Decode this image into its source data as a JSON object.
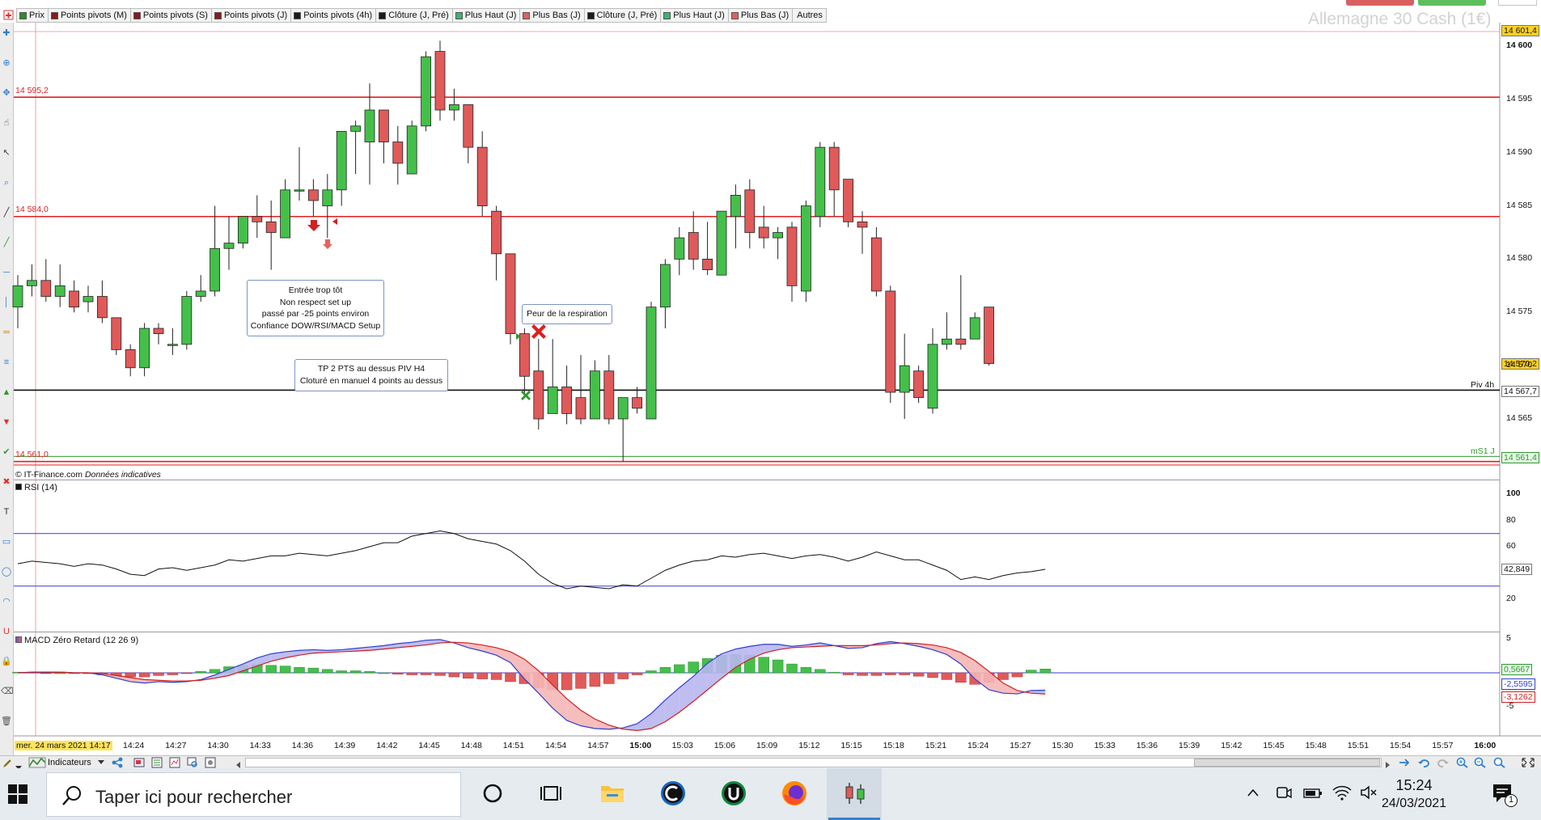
{
  "toolbar": {
    "tabs": [
      {
        "label": "Prix",
        "color": "#2e8b2e"
      },
      {
        "label": "Points pivots (M)",
        "color": "#8b1a1a"
      },
      {
        "label": "Points pivots (S)",
        "color": "#8b1a1a"
      },
      {
        "label": "Points pivots (J)",
        "color": "#8b1a1a"
      },
      {
        "label": "Points pivots (4h)",
        "color": "#1a1a1a"
      },
      {
        "label": "Clôture (J, Pré)",
        "color": "#1a1a1a"
      },
      {
        "label": "Plus Haut (J)",
        "color": "#3cb371"
      },
      {
        "label": "Plus Bas (J)",
        "color": "#e06060"
      },
      {
        "label": "Clôture (J, Pré)",
        "color": "#1a1a1a"
      },
      {
        "label": "Plus Haut (J)",
        "color": "#3cb371"
      },
      {
        "label": "Plus Bas (J)",
        "color": "#e06060"
      },
      {
        "label": "Autres",
        "color": ""
      }
    ],
    "instrument_title": "Allemagne 30 Cash (1€)"
  },
  "price_pane": {
    "copyright": "© IT-Finance.com",
    "disclaimer": "Données indicatives",
    "levels": [
      {
        "label": "14 595,2",
        "value": 14595.2,
        "color": "#e02020"
      },
      {
        "label": "14 584,0",
        "value": 14584.0,
        "color": "#e02020"
      },
      {
        "label": "14 561,0",
        "value": 14561.0,
        "color": "#e02020"
      }
    ],
    "pivot_4h": {
      "label": "Piv 4h",
      "value": 14567.7,
      "tag": "14 567,7"
    },
    "ms1_j": {
      "label": "mS1 J",
      "value": 14561.4,
      "tag": "14 561,4"
    },
    "top_tag": "14 601,4",
    "last_price_tag": "14 570,2",
    "price_ticks": [
      "14 600",
      "14 595",
      "14 590",
      "14 585",
      "14 580",
      "14 575",
      "14 570",
      "14 565"
    ],
    "annotations": {
      "note1": [
        "Entrée trop tôt",
        "Non respect set up",
        "passé par -25 points environ",
        "Confiance DOW/RSI/MACD Setup"
      ],
      "note2": [
        "Peur de la respiration"
      ],
      "note3": [
        "TP 2 PTS au dessus PIV H4",
        "Cloturé en manuel 4 points au dessus"
      ]
    }
  },
  "rsi_pane": {
    "label": "RSI (14)",
    "ticks": [
      "100",
      "80",
      "60",
      "40",
      "20"
    ],
    "value_tag": "42,849",
    "upper": 70,
    "lower": 30
  },
  "macd_pane": {
    "label": "MACD Zéro Retard (12 26 9)",
    "ticks": [
      "5",
      "0",
      "-5"
    ],
    "tag_hist": "0,5667",
    "tag_macd": "-2,5595",
    "tag_signal": "-3,1262"
  },
  "time_axis": {
    "date_label": "mer. 24 mars 2021 14:17",
    "labels": [
      "14:24",
      "14:27",
      "14:30",
      "14:33",
      "14:36",
      "14:39",
      "14:42",
      "14:45",
      "14:48",
      "14:51",
      "14:54",
      "14:57",
      "15:00",
      "15:03",
      "15:06",
      "15:09",
      "15:12",
      "15:15",
      "15:18",
      "15:21",
      "15:24",
      "15:27",
      "15:30",
      "15:33",
      "15:36",
      "15:39",
      "15:42",
      "15:45",
      "15:48",
      "15:51",
      "15:54",
      "15:57",
      "16:00"
    ]
  },
  "bottom_toolbar": {
    "indicators_label": "Indicateurs"
  },
  "taskbar": {
    "search_placeholder": "Taper ici pour rechercher",
    "time": "15:24",
    "date": "24/03/2021",
    "notif_count": "1"
  },
  "chart_data": {
    "type": "candlestick",
    "instrument": "Allemagne 30 Cash (1€)",
    "timeframe_minutes": 1,
    "start_time": "14:17",
    "y_range": [
      14561,
      14602
    ],
    "candles": [
      {
        "t": "14:17",
        "o": 14575.5,
        "h": 14578.5,
        "l": 14573.5,
        "c": 14577.5
      },
      {
        "t": "14:18",
        "o": 14577.5,
        "h": 14579.5,
        "l": 14576.5,
        "c": 14578.0
      },
      {
        "t": "14:19",
        "o": 14578.0,
        "h": 14580.0,
        "l": 14576.0,
        "c": 14576.5
      },
      {
        "t": "14:20",
        "o": 14576.5,
        "h": 14579.5,
        "l": 14575.5,
        "c": 14577.5
      },
      {
        "t": "14:21",
        "o": 14577.0,
        "h": 14578.0,
        "l": 14575.0,
        "c": 14575.5
      },
      {
        "t": "14:22",
        "o": 14576.0,
        "h": 14577.5,
        "l": 14575.0,
        "c": 14576.5
      },
      {
        "t": "14:23",
        "o": 14576.5,
        "h": 14578.0,
        "l": 14574.0,
        "c": 14574.5
      },
      {
        "t": "14:24",
        "o": 14574.5,
        "h": 14574.5,
        "l": 14571.0,
        "c": 14571.5
      },
      {
        "t": "14:25",
        "o": 14571.5,
        "h": 14572.0,
        "l": 14569.0,
        "c": 14569.8
      },
      {
        "t": "14:26",
        "o": 14569.8,
        "h": 14574.0,
        "l": 14569.0,
        "c": 14573.5
      },
      {
        "t": "14:27",
        "o": 14573.5,
        "h": 14574.0,
        "l": 14572.0,
        "c": 14573.0
      },
      {
        "t": "14:28",
        "o": 14572.0,
        "h": 14573.5,
        "l": 14571.0,
        "c": 14572.0
      },
      {
        "t": "14:29",
        "o": 14572.0,
        "h": 14577.0,
        "l": 14571.5,
        "c": 14576.5
      },
      {
        "t": "14:30",
        "o": 14576.5,
        "h": 14578.5,
        "l": 14576.0,
        "c": 14577.0
      },
      {
        "t": "14:31",
        "o": 14577.0,
        "h": 14585.0,
        "l": 14576.5,
        "c": 14581.0
      },
      {
        "t": "14:32",
        "o": 14581.0,
        "h": 14584.0,
        "l": 14579.0,
        "c": 14581.5
      },
      {
        "t": "14:33",
        "o": 14581.5,
        "h": 14584.0,
        "l": 14581.0,
        "c": 14584.0
      },
      {
        "t": "14:34",
        "o": 14584.0,
        "h": 14586.0,
        "l": 14582.0,
        "c": 14583.5
      },
      {
        "t": "14:35",
        "o": 14583.5,
        "h": 14585.5,
        "l": 14579.0,
        "c": 14582.5
      },
      {
        "t": "14:36",
        "o": 14582.0,
        "h": 14587.5,
        "l": 14582.0,
        "c": 14586.5
      },
      {
        "t": "14:37",
        "o": 14586.5,
        "h": 14590.5,
        "l": 14585.5,
        "c": 14586.5
      },
      {
        "t": "14:38",
        "o": 14586.5,
        "h": 14587.5,
        "l": 14584.0,
        "c": 14585.5
      },
      {
        "t": "14:39",
        "o": 14585.0,
        "h": 14588.0,
        "l": 14582.0,
        "c": 14586.5
      },
      {
        "t": "14:40",
        "o": 14586.5,
        "h": 14592.0,
        "l": 14585.0,
        "c": 14592.0
      },
      {
        "t": "14:41",
        "o": 14592.0,
        "h": 14593.0,
        "l": 14588.0,
        "c": 14592.5
      },
      {
        "t": "14:42",
        "o": 14591.0,
        "h": 14596.5,
        "l": 14587.0,
        "c": 14594.0
      },
      {
        "t": "14:43",
        "o": 14594.0,
        "h": 14594.0,
        "l": 14589.0,
        "c": 14591.0
      },
      {
        "t": "14:44",
        "o": 14591.0,
        "h": 14592.5,
        "l": 14587.0,
        "c": 14589.0
      },
      {
        "t": "14:45",
        "o": 14588.0,
        "h": 14593.0,
        "l": 14588.0,
        "c": 14592.5
      },
      {
        "t": "14:46",
        "o": 14592.5,
        "h": 14599.5,
        "l": 14592.0,
        "c": 14599.0
      },
      {
        "t": "14:47",
        "o": 14599.5,
        "h": 14600.5,
        "l": 14593.0,
        "c": 14594.0
      },
      {
        "t": "14:48",
        "o": 14594.0,
        "h": 14596.0,
        "l": 14593.0,
        "c": 14594.5
      },
      {
        "t": "14:49",
        "o": 14594.5,
        "h": 14594.5,
        "l": 14589.0,
        "c": 14590.5
      },
      {
        "t": "14:50",
        "o": 14590.5,
        "h": 14592.0,
        "l": 14584.0,
        "c": 14585.0
      },
      {
        "t": "14:51",
        "o": 14584.5,
        "h": 14585.0,
        "l": 14578.0,
        "c": 14580.5
      },
      {
        "t": "14:52",
        "o": 14580.5,
        "h": 14580.5,
        "l": 14572.0,
        "c": 14573.0
      },
      {
        "t": "14:53",
        "o": 14573.0,
        "h": 14573.5,
        "l": 14567.0,
        "c": 14569.0
      },
      {
        "t": "14:54",
        "o": 14569.5,
        "h": 14572.5,
        "l": 14564.0,
        "c": 14565.0
      },
      {
        "t": "14:55",
        "o": 14565.5,
        "h": 14572.5,
        "l": 14565.5,
        "c": 14568.0
      },
      {
        "t": "14:56",
        "o": 14568.0,
        "h": 14570.0,
        "l": 14564.5,
        "c": 14565.5
      },
      {
        "t": "14:57",
        "o": 14567.0,
        "h": 14571.0,
        "l": 14564.5,
        "c": 14565.0
      },
      {
        "t": "14:58",
        "o": 14565.0,
        "h": 14570.5,
        "l": 14565.0,
        "c": 14569.5
      },
      {
        "t": "14:59",
        "o": 14569.5,
        "h": 14571.0,
        "l": 14564.5,
        "c": 14565.0
      },
      {
        "t": "15:00",
        "o": 14565.0,
        "h": 14567.0,
        "l": 14561.0,
        "c": 14567.0
      },
      {
        "t": "15:01",
        "o": 14567.0,
        "h": 14568.0,
        "l": 14565.5,
        "c": 14566.0
      },
      {
        "t": "15:02",
        "o": 14565.0,
        "h": 14576.0,
        "l": 14565.0,
        "c": 14575.5
      },
      {
        "t": "15:03",
        "o": 14575.5,
        "h": 14580.0,
        "l": 14573.5,
        "c": 14579.5
      },
      {
        "t": "15:04",
        "o": 14580.0,
        "h": 14583.0,
        "l": 14578.5,
        "c": 14582.0
      },
      {
        "t": "15:05",
        "o": 14582.5,
        "h": 14584.5,
        "l": 14579.0,
        "c": 14580.0
      },
      {
        "t": "15:06",
        "o": 14580.0,
        "h": 14583.5,
        "l": 14578.5,
        "c": 14579.0
      },
      {
        "t": "15:07",
        "o": 14578.5,
        "h": 14584.5,
        "l": 14578.5,
        "c": 14584.5
      },
      {
        "t": "15:08",
        "o": 14584.0,
        "h": 14587.0,
        "l": 14581.0,
        "c": 14586.0
      },
      {
        "t": "15:09",
        "o": 14586.5,
        "h": 14587.5,
        "l": 14581.0,
        "c": 14582.5
      },
      {
        "t": "15:10",
        "o": 14583.0,
        "h": 14585.0,
        "l": 14581.0,
        "c": 14582.0
      },
      {
        "t": "15:11",
        "o": 14582.0,
        "h": 14583.0,
        "l": 14580.0,
        "c": 14582.5
      },
      {
        "t": "15:12",
        "o": 14583.0,
        "h": 14583.5,
        "l": 14576.0,
        "c": 14577.5
      },
      {
        "t": "15:13",
        "o": 14577.0,
        "h": 14585.5,
        "l": 14576.0,
        "c": 14585.0
      },
      {
        "t": "15:14",
        "o": 14584.0,
        "h": 14591.0,
        "l": 14583.0,
        "c": 14590.5
      },
      {
        "t": "15:15",
        "o": 14590.5,
        "h": 14591.0,
        "l": 14584.0,
        "c": 14586.5
      },
      {
        "t": "15:16",
        "o": 14587.5,
        "h": 14587.5,
        "l": 14583.0,
        "c": 14583.5
      },
      {
        "t": "15:17",
        "o": 14583.5,
        "h": 14584.5,
        "l": 14580.5,
        "c": 14583.0
      },
      {
        "t": "15:18",
        "o": 14582.0,
        "h": 14583.0,
        "l": 14576.5,
        "c": 14577.0
      },
      {
        "t": "15:19",
        "o": 14577.0,
        "h": 14577.5,
        "l": 14566.5,
        "c": 14567.5
      },
      {
        "t": "15:20",
        "o": 14567.5,
        "h": 14573.0,
        "l": 14565.0,
        "c": 14570.0
      },
      {
        "t": "15:21",
        "o": 14569.5,
        "h": 14570.0,
        "l": 14566.5,
        "c": 14567.0
      },
      {
        "t": "15:22",
        "o": 14566.0,
        "h": 14573.5,
        "l": 14565.5,
        "c": 14572.0
      },
      {
        "t": "15:23",
        "o": 14572.0,
        "h": 14575.0,
        "l": 14571.5,
        "c": 14572.5
      },
      {
        "t": "15:24",
        "o": 14572.5,
        "h": 14578.5,
        "l": 14571.5,
        "c": 14572.0
      },
      {
        "t": "15:25",
        "o": 14572.5,
        "h": 14575.0,
        "l": 14572.5,
        "c": 14574.5
      },
      {
        "t": "15:26",
        "o": 14575.5,
        "h": 14575.5,
        "l": 14570.0,
        "c": 14570.2
      }
    ],
    "rsi_values": [
      47,
      49,
      48,
      47,
      45,
      47,
      46,
      43,
      39,
      38,
      43,
      44,
      42,
      44,
      46,
      50,
      49,
      51,
      53,
      53,
      55,
      54,
      53,
      55,
      57,
      60,
      63,
      63,
      68,
      70,
      72,
      70,
      66,
      64,
      62,
      57,
      49,
      39,
      32,
      28,
      30,
      29,
      28,
      31,
      30,
      36,
      42,
      46,
      49,
      50,
      53,
      52,
      54,
      55,
      53,
      51,
      53,
      54,
      52,
      49,
      52,
      56,
      53,
      50,
      50,
      46,
      42,
      35,
      37,
      35,
      38,
      40,
      41,
      42.8
    ],
    "macd_line": [
      0,
      0.1,
      0.1,
      0.1,
      0,
      0,
      -0.3,
      -0.8,
      -1.3,
      -1.5,
      -1.3,
      -1.4,
      -1.3,
      -1.0,
      -0.3,
      0.5,
      1.3,
      2.2,
      2.8,
      3.1,
      3.3,
      3.4,
      3.3,
      3.4,
      3.6,
      3.8,
      4.0,
      4.3,
      4.5,
      4.8,
      4.9,
      4.4,
      3.7,
      3.2,
      2.6,
      1.5,
      -0.9,
      -3.0,
      -5.2,
      -7.0,
      -7.8,
      -8.2,
      -8.3,
      -8.1,
      -7.5,
      -6.0,
      -4.0,
      -2.2,
      -0.5,
      1.4,
      2.8,
      3.5,
      3.9,
      4.2,
      4.2,
      3.9,
      4.1,
      4.4,
      4.0,
      3.6,
      3.7,
      4.3,
      4.6,
      4.3,
      3.9,
      3.4,
      2.7,
      1.3,
      -0.9,
      -2.5,
      -3.0,
      -3.1,
      -2.6,
      -2.56
    ],
    "signal_line": [
      0,
      0,
      0,
      0.1,
      0,
      0,
      -0.1,
      -0.4,
      -0.7,
      -1.0,
      -1.1,
      -1.2,
      -1.2,
      -1.1,
      -0.8,
      -0.4,
      0.3,
      1.0,
      1.7,
      2.2,
      2.6,
      2.9,
      3.0,
      3.1,
      3.2,
      3.3,
      3.5,
      3.7,
      3.9,
      4.1,
      4.4,
      4.5,
      4.4,
      4.1,
      3.7,
      3.1,
      2.0,
      0.3,
      -1.8,
      -3.8,
      -5.5,
      -6.8,
      -7.7,
      -8.3,
      -8.5,
      -8.2,
      -7.2,
      -5.8,
      -4.2,
      -2.5,
      -0.8,
      0.8,
      2.0,
      2.9,
      3.4,
      3.7,
      3.8,
      3.9,
      4.0,
      4.0,
      4.0,
      4.1,
      4.3,
      4.4,
      4.3,
      4.1,
      3.7,
      3.0,
      1.8,
      0.2,
      -1.5,
      -2.6,
      -3.0,
      -3.1262
    ],
    "macd_histogram": [
      0.1,
      0.1,
      0,
      0,
      0,
      -0.1,
      -0.3,
      -0.4,
      -0.6,
      -0.6,
      -0.4,
      -0.3,
      -0.1,
      0.2,
      0.5,
      0.9,
      1.1,
      1.2,
      1.1,
      1.0,
      0.8,
      0.7,
      0.5,
      0.3,
      0.3,
      0.2,
      0,
      -0.2,
      -0.3,
      -0.3,
      -0.4,
      -0.6,
      -0.8,
      -0.9,
      -1.0,
      -1.3,
      -1.6,
      -2.2,
      -2.5,
      -2.5,
      -2.3,
      -2.0,
      -1.6,
      -0.9,
      -0.3,
      0.3,
      0.8,
      1.2,
      1.6,
      2.1,
      2.6,
      2.7,
      2.6,
      2.3,
      1.9,
      1.3,
      0.8,
      0.5,
      0.1,
      -0.3,
      -0.4,
      -0.4,
      -0.3,
      -0.3,
      -0.5,
      -0.7,
      -1.0,
      -1.4,
      -1.7,
      -1.4,
      -1.0,
      -0.6,
      0.4,
      0.5667
    ]
  }
}
